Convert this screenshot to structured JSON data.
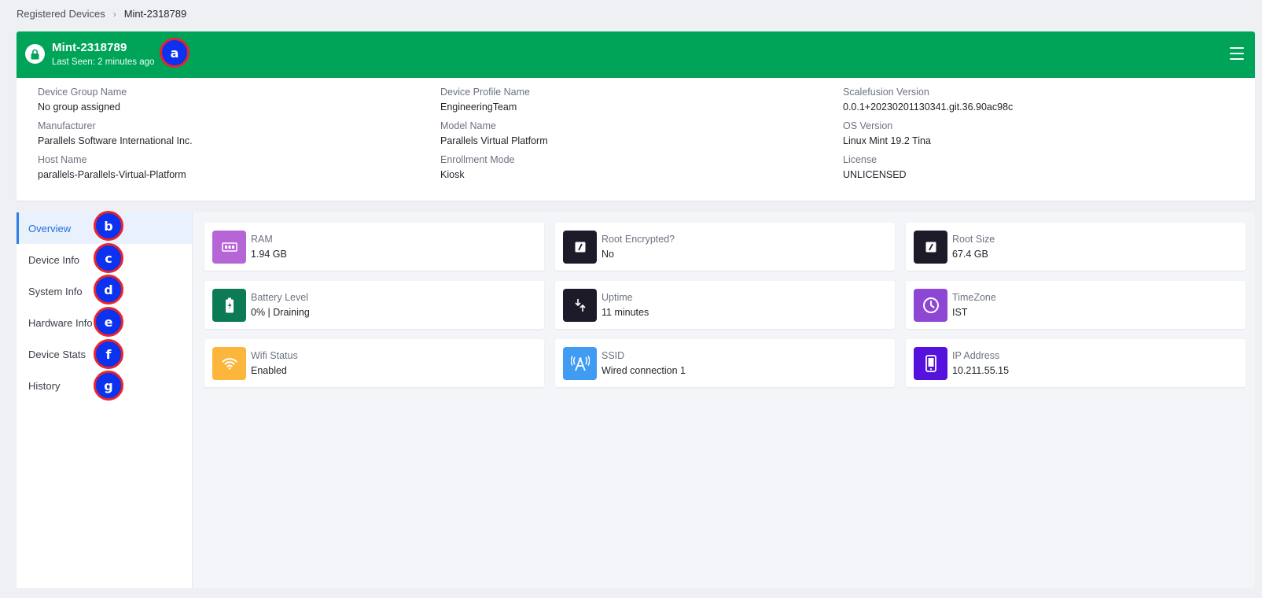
{
  "breadcrumb": {
    "parent": "Registered Devices",
    "separator": "›",
    "current": "Mint-2318789"
  },
  "device": {
    "name": "Mint-2318789",
    "last_seen": "Last Seen: 2 minutes ago",
    "header_color": "#00a459",
    "info": [
      {
        "label": "Device Group Name",
        "value": "No group assigned"
      },
      {
        "label": "Device Profile Name",
        "value": "EngineeringTeam"
      },
      {
        "label": "Scalefusion Version",
        "value": "0.0.1+20230201130341.git.36.90ac98c"
      },
      {
        "label": "Manufacturer",
        "value": "Parallels Software International Inc."
      },
      {
        "label": "Model Name",
        "value": "Parallels Virtual Platform"
      },
      {
        "label": "OS Version",
        "value": "Linux Mint 19.2 Tina"
      },
      {
        "label": "Host Name",
        "value": "parallels-Parallels-Virtual-Platform"
      },
      {
        "label": "Enrollment Mode",
        "value": "Kiosk"
      },
      {
        "label": "License",
        "value": "UNLICENSED"
      }
    ]
  },
  "nav": {
    "items": [
      {
        "label": "Overview",
        "active": true
      },
      {
        "label": "Device Info"
      },
      {
        "label": "System Info"
      },
      {
        "label": "Hardware Info"
      },
      {
        "label": "Device Stats"
      },
      {
        "label": "History"
      }
    ]
  },
  "stats": [
    {
      "label": "RAM",
      "value": "1.94 GB",
      "icon": "ram-icon",
      "color": "#b565d6"
    },
    {
      "label": "Root Encrypted?",
      "value": "No",
      "icon": "disk-icon",
      "color": "#1d1b29"
    },
    {
      "label": "Root Size",
      "value": "67.4 GB",
      "icon": "disk-icon",
      "color": "#1d1b29"
    },
    {
      "label": "Battery Level",
      "value": "0% | Draining",
      "icon": "battery-icon",
      "color": "#0b7a55"
    },
    {
      "label": "Uptime",
      "value": "11 minutes",
      "icon": "uptime-icon",
      "color": "#1d1b29"
    },
    {
      "label": "TimeZone",
      "value": "IST",
      "icon": "clock-icon",
      "color": "#8e46d4"
    },
    {
      "label": "Wifi Status",
      "value": "Enabled",
      "icon": "wifi-icon",
      "color": "#fdb63c"
    },
    {
      "label": "SSID",
      "value": "Wired connection 1",
      "icon": "antenna-icon",
      "color": "#3f9cf2"
    },
    {
      "label": "IP Address",
      "value": "10.211.55.15",
      "icon": "phone-icon",
      "color": "#5512dc"
    }
  ],
  "markers": [
    "a",
    "b",
    "c",
    "d",
    "e",
    "f",
    "g"
  ]
}
